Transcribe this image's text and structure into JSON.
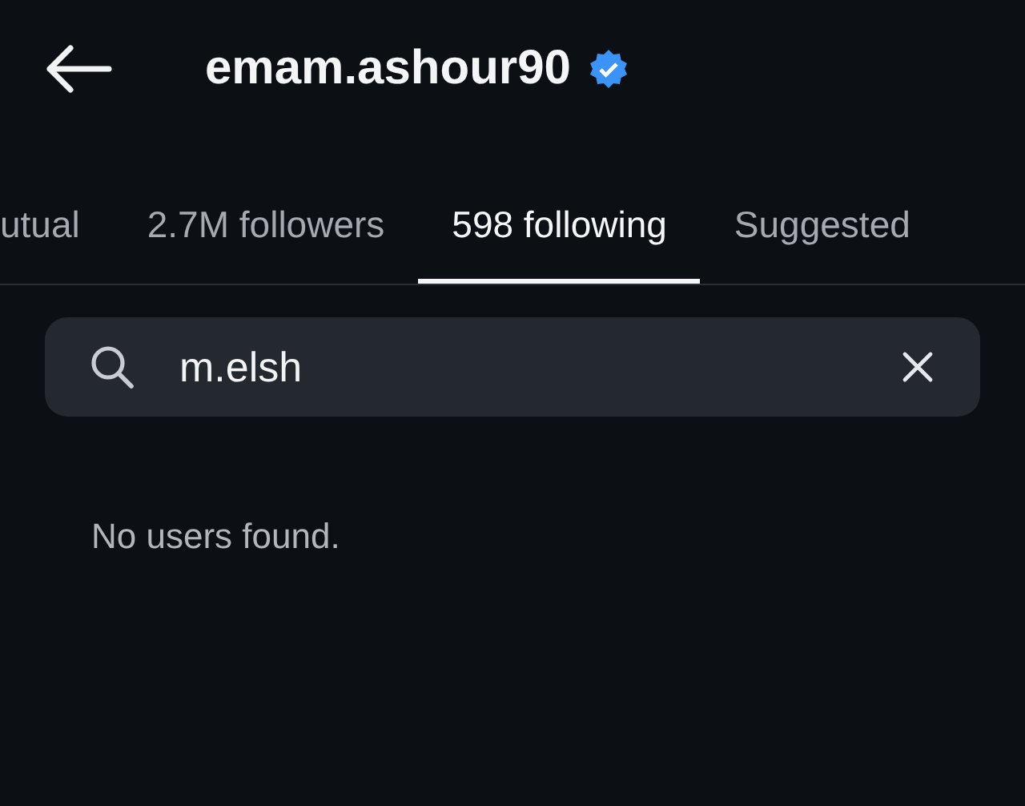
{
  "header": {
    "title": "emam.ashour90",
    "verified": true
  },
  "tabs": [
    {
      "label": "utual",
      "selected": false
    },
    {
      "label": "2.7M followers",
      "selected": false
    },
    {
      "label": "598 following",
      "selected": true
    },
    {
      "label": "Suggested",
      "selected": false
    }
  ],
  "search": {
    "value": "m.elsh"
  },
  "message": "No users found."
}
